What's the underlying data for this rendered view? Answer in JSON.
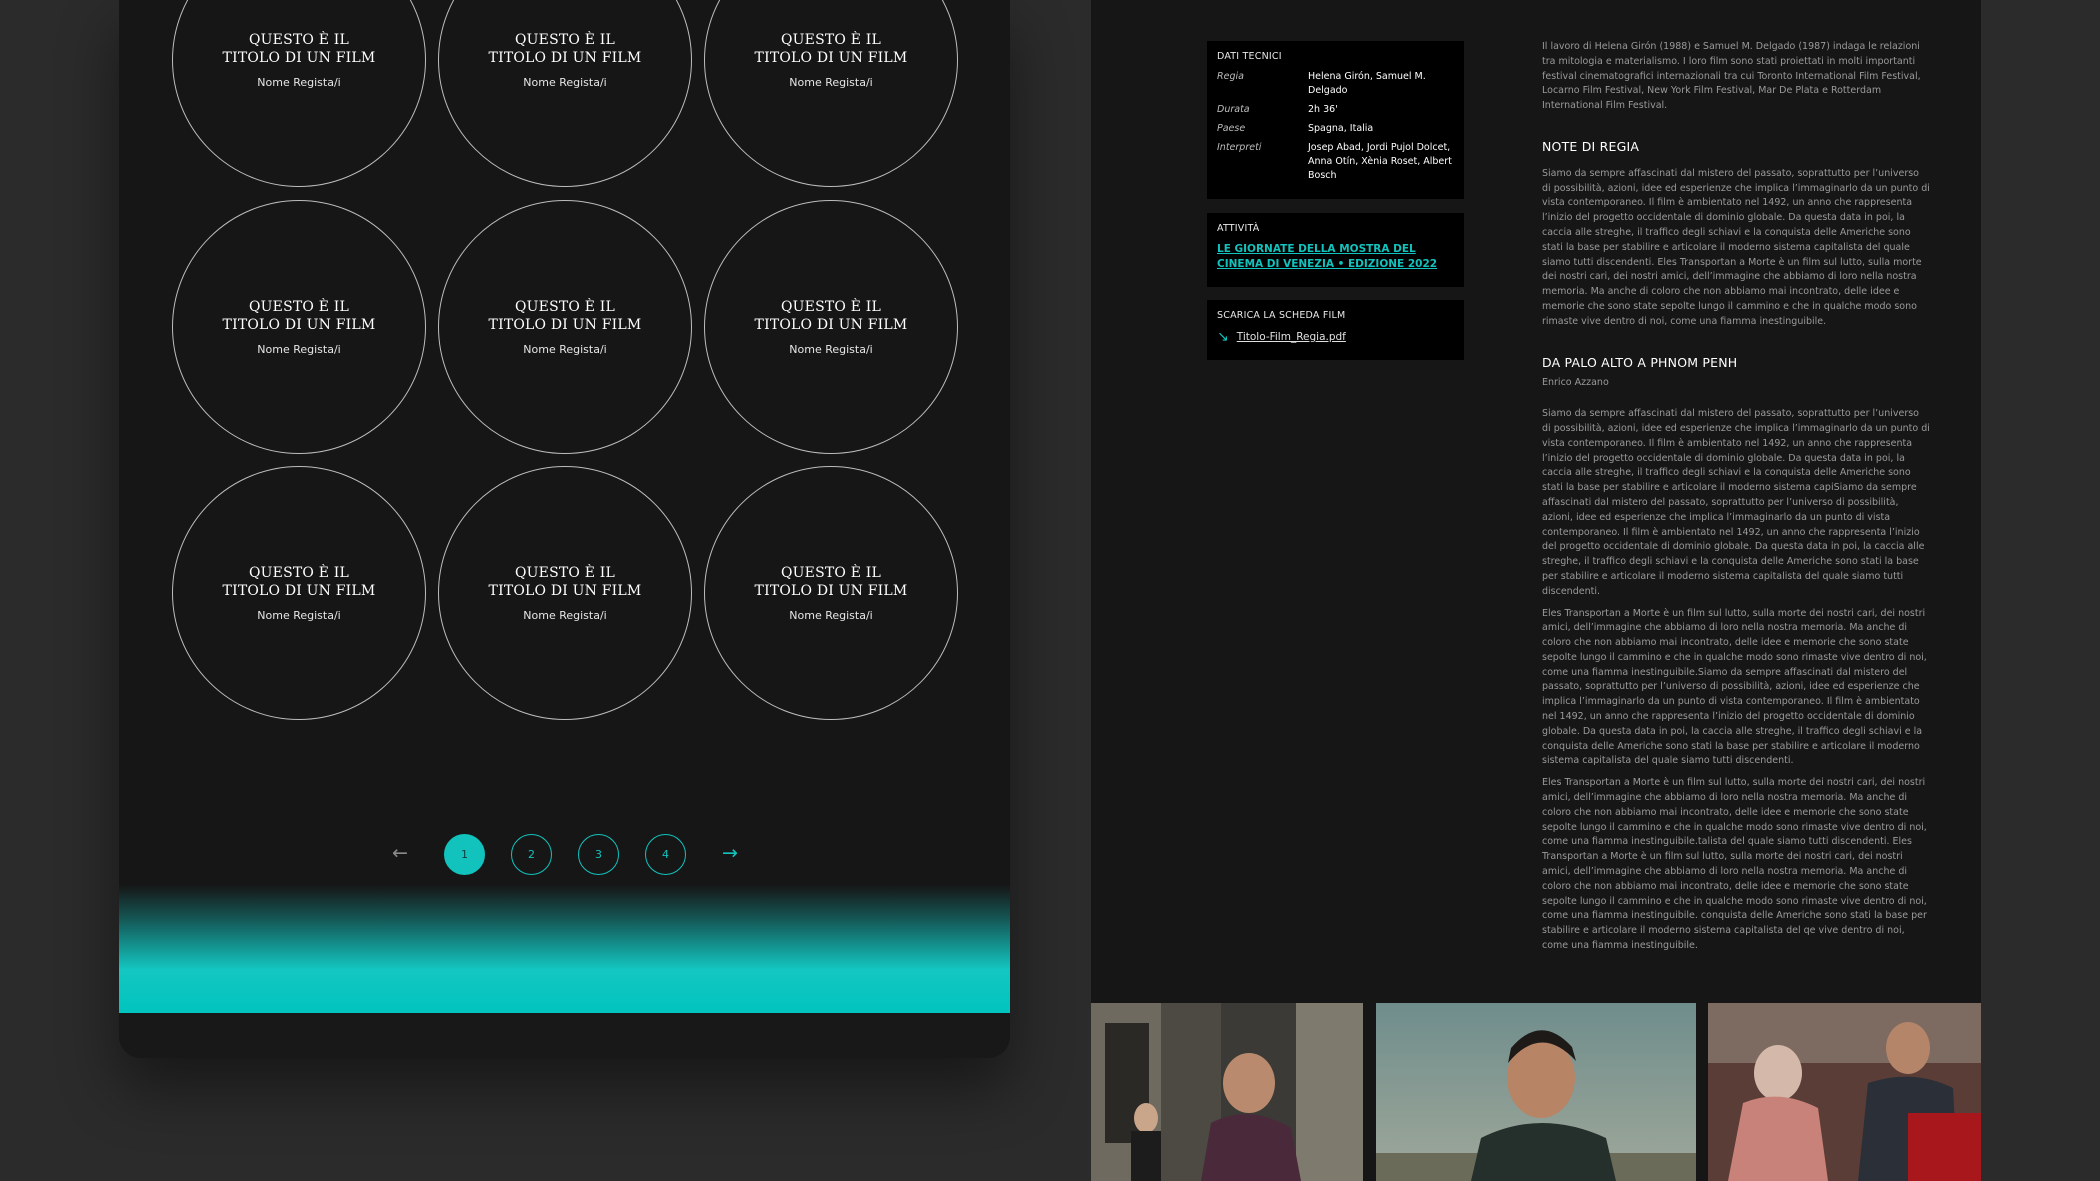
{
  "films_grid": {
    "items": [
      {
        "title": "QUESTO È IL TITOLO DI UN FILM",
        "director": "Nome Regista/i"
      },
      {
        "title": "QUESTO È IL TITOLO DI UN FILM",
        "director": "Nome Regista/i"
      },
      {
        "title": "QUESTO È IL TITOLO DI UN FILM",
        "director": "Nome Regista/i"
      },
      {
        "title": "QUESTO È IL TITOLO DI UN FILM",
        "director": "Nome Regista/i"
      },
      {
        "title": "QUESTO È IL TITOLO DI UN FILM",
        "director": "Nome Regista/i"
      },
      {
        "title": "QUESTO È IL TITOLO DI UN FILM",
        "director": "Nome Regista/i"
      },
      {
        "title": "QUESTO È IL TITOLO DI UN FILM",
        "director": "Nome Regista/i"
      },
      {
        "title": "QUESTO È IL TITOLO DI UN FILM",
        "director": "Nome Regista/i"
      },
      {
        "title": "QUESTO È IL TITOLO DI UN FILM",
        "director": "Nome Regista/i"
      }
    ]
  },
  "pagination": {
    "prev_icon": "arrow-left-icon",
    "next_icon": "arrow-right-icon",
    "pages": [
      "1",
      "2",
      "3",
      "4"
    ],
    "current": "1"
  },
  "tech_data": {
    "title": "DATI TECNICI",
    "rows": [
      {
        "label": "Regia",
        "value": "Helena Girón, Samuel M. Delgado"
      },
      {
        "label": "Durata",
        "value": "2h 36'"
      },
      {
        "label": "Paese",
        "value": "Spagna, Italia"
      },
      {
        "label": "Interpreti",
        "value": "Josep Abad, Jordi Pujol Dolcet, Anna Otín, Xènia Roset, Albert Bosch"
      }
    ]
  },
  "activity": {
    "title": "ATTIVITÀ",
    "link": "LE GIORNATE DELLA MOSTRA DEL CINEMA DI VENEZIA • EDIZIONE 2022"
  },
  "download": {
    "title": "SCARICA LA SCHEDA FILM",
    "icon": "arrow-down-right-icon",
    "file": "Titolo-Film_Regia.pdf"
  },
  "article": {
    "intro": "Il lavoro di Helena Girón (1988) e Samuel M. Delgado (1987) indaga le relazioni tra mitologia e materialismo. I loro film sono stati proiettati in molti importanti festival cinematografici internazionali tra cui Toronto International Film Festival, Locarno Film Festival, New York Film Festival, Mar De Plata e Rotterdam International Film Festival.",
    "notes_title": "NOTE DI REGIA",
    "notes_text": "Siamo da sempre affascinati dal mistero del passato, soprattutto per l’universo di possibilità, azioni, idee ed esperienze che implica l’immaginarlo da un punto di vista contemporaneo. Il film è ambientato nel 1492, un anno che rappresenta l’inizio del progetto occidentale di dominio globale. Da questa data in poi, la caccia alle streghe, il traffico degli schiavi e la conquista delle Americhe sono stati la base per stabilire e articolare il moderno sistema capitalista del quale siamo tutti discendenti. Eles Transportan a Morte è un film sul lutto, sulla morte dei nostri cari, dei nostri amici, dell’immagine che abbiamo di loro nella nostra memoria. Ma anche di coloro che non abbiamo mai incontrato, delle idee e memorie che sono state sepolte lungo il cammino e che in qualche modo sono rimaste vive dentro di noi, come una fiamma inestinguibile.",
    "section2_title": "DA PALO ALTO A PHNOM PENH",
    "section2_author": "Enrico Azzano",
    "section2_p1": "Siamo da sempre affascinati dal mistero del passato, soprattutto per l’universo di possibilità, azioni, idee ed esperienze che implica l’immaginarlo da un punto di vista contemporaneo. Il film è ambientato nel 1492, un anno che rappresenta l’inizio del progetto occidentale di dominio globale. Da questa data in poi, la caccia alle streghe, il traffico degli schiavi e la conquista delle Americhe sono stati la base per stabilire e articolare il moderno sistema capiSiamo da sempre affascinati dal mistero del passato, soprattutto per l’universo di possibilità, azioni, idee ed esperienze che implica l’immaginarlo da un punto di vista contemporaneo. Il film è ambientato nel 1492, un anno che rappresenta l’inizio del progetto occidentale di dominio globale. Da questa data in poi, la caccia alle streghe, il traffico degli schiavi e la conquista delle Americhe sono stati la base per stabilire e articolare il moderno sistema capitalista del quale siamo tutti discendenti.",
    "section2_p2": "Eles Transportan a Morte è un film sul lutto, sulla morte dei nostri cari, dei nostri amici, dell’immagine che abbiamo di loro nella nostra memoria. Ma anche di coloro che non abbiamo mai incontrato, delle idee e memorie che sono state sepolte lungo il cammino e che in qualche modo sono rimaste vive dentro di noi, come una fiamma inestinguibile.Siamo da sempre affascinati dal mistero del passato, soprattutto per l’universo di possibilità, azioni, idee ed esperienze che implica l’immaginarlo da un punto di vista contemporaneo. Il film è ambientato nel 1492, un anno che rappresenta l’inizio del progetto occidentale di dominio globale. Da questa data in poi, la caccia alle streghe, il traffico degli schiavi e la conquista delle Americhe sono stati la base per stabilire e articolare il moderno sistema capitalista del quale siamo tutti discendenti.",
    "section2_p3": "Eles Transportan a Morte è un film sul lutto, sulla morte dei nostri cari, dei nostri amici, dell’immagine che abbiamo di loro nella nostra memoria. Ma anche di coloro che non abbiamo mai incontrato, delle idee e memorie che sono state sepolte lungo il cammino e che in qualche modo sono rimaste vive dentro di noi, come una fiamma inestinguibile.talista del quale siamo tutti discendenti. Eles Transportan a Morte è un film sul lutto, sulla morte dei nostri cari, dei nostri amici, dell’immagine che abbiamo di loro nella nostra memoria. Ma anche di coloro che non abbiamo mai incontrato, delle idee e memorie che sono state sepolte lungo il cammino e che in qualche modo sono rimaste vive dentro di noi, come una fiamma inestinguibile. conquista delle Americhe sono stati la base per stabilire e articolare il moderno sistema capitalista del qe vive dentro di noi, come una fiamma inestinguibile."
  },
  "colors": {
    "accent": "#12c2bd",
    "panel_bg": "#161616",
    "page_bg": "#2b2b2b"
  }
}
